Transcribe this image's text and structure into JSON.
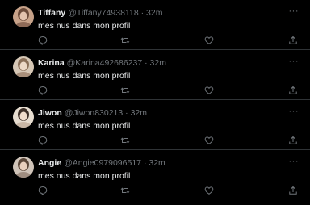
{
  "tweets": [
    {
      "name": "Tiffany",
      "handle": "@Tiffany74938118",
      "time": "· 32m",
      "text": "mes nus dans mon profil",
      "avatar_color": "#b98f76"
    },
    {
      "name": "Karina",
      "handle": "@Karina492686237",
      "time": "· 32m",
      "text": "mes nus dans mon profil",
      "avatar_color": "#c7b6a3"
    },
    {
      "name": "Jiwon",
      "handle": "@Jiwon830213",
      "time": "· 32m",
      "text": "mes nus dans mon profil",
      "avatar_color": "#d8c8b4"
    },
    {
      "name": "Angie",
      "handle": "@Angie0979096517",
      "time": "· 32m",
      "text": "mes nus dans mon profil",
      "avatar_color": "#b7a79a"
    }
  ],
  "more_label": "···",
  "icons": [
    "reply-icon",
    "retweet-icon",
    "like-icon",
    "share-icon"
  ],
  "colors": {
    "background": "#000000",
    "text": "#e7e9ea",
    "muted": "#71767b",
    "divider": "#2f3336"
  }
}
